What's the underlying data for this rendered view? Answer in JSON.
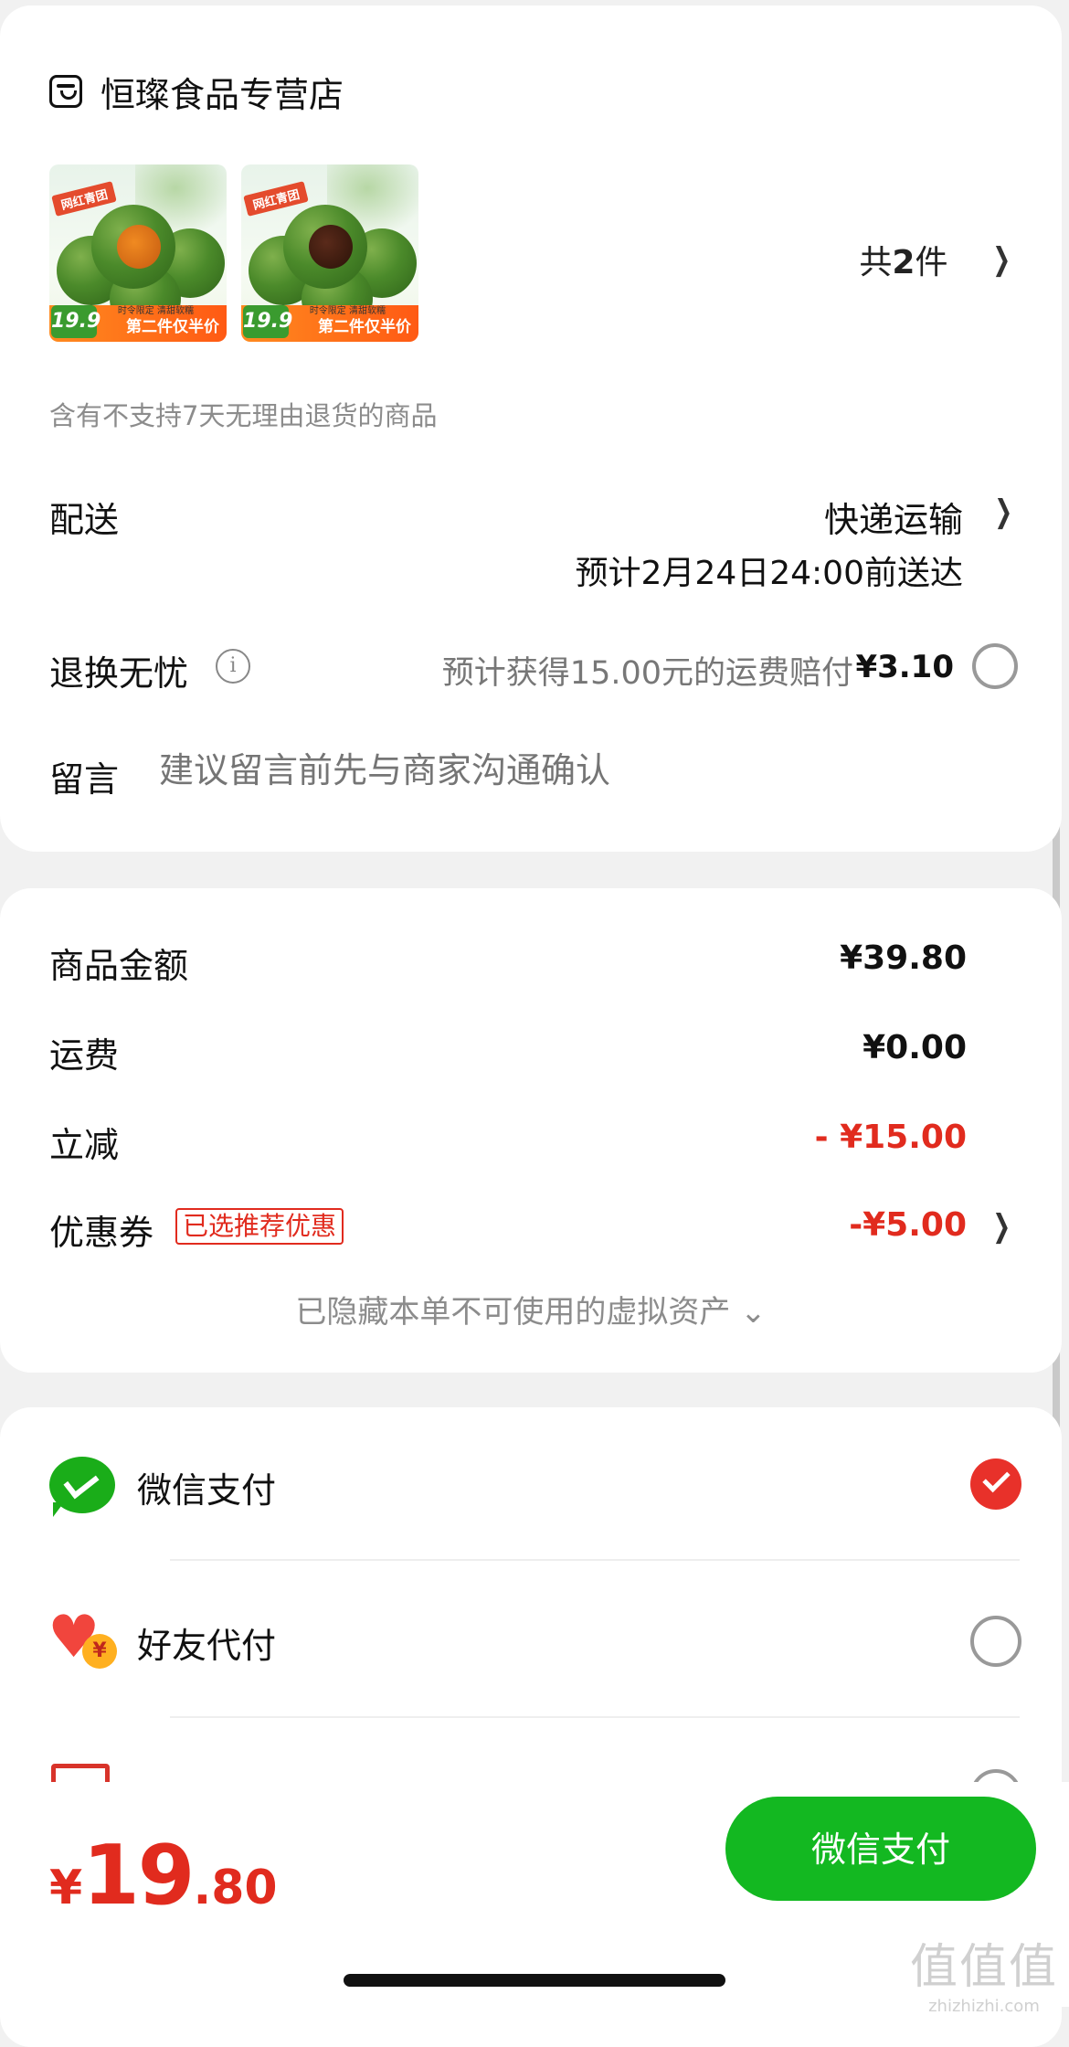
{
  "store": {
    "name": "恒璨食品专营店"
  },
  "products": [
    {
      "tag": "网红青团",
      "price_badge": "19.9",
      "band_text": "第二件仅半价",
      "band_small": "时令限定 清甜软糯",
      "filling_color": "#f08a21"
    },
    {
      "tag": "网红青团",
      "price_badge": "19.9",
      "band_text": "第二件仅半价",
      "band_small": "时令限定 清甜软糯",
      "filling_color": "#5a2a1a"
    }
  ],
  "item_count": {
    "prefix": "共",
    "count": "2",
    "suffix": "件"
  },
  "return_note": "含有不支持7天无理由退货的商品",
  "shipping": {
    "label": "配送",
    "method": "快递运输",
    "eta": "预计2月24日24:00前送达"
  },
  "return_worry_free": {
    "label": "退换无忧",
    "info_icon": "i",
    "description": "预计获得15.00元的运费赔付",
    "price": "¥3.10"
  },
  "message": {
    "label": "留言",
    "placeholder": "建议留言前先与商家沟通确认"
  },
  "summary": {
    "goods_amount_label": "商品金额",
    "goods_amount": "¥39.80",
    "shipping_fee_label": "运费",
    "shipping_fee": "¥0.00",
    "discount_label": "立减",
    "discount": "- ¥15.00",
    "coupon_label": "优惠券",
    "coupon_badge": "已选推荐优惠",
    "coupon_value": "-¥5.00",
    "hidden_assets": "已隐藏本单不可使用的虚拟资产 ⌄"
  },
  "payment_methods": {
    "wechat": "微信支付",
    "friend": "好友代付",
    "friend_coin": "¥",
    "third": "",
    "selected": "wechat"
  },
  "footer": {
    "total_symbol": "¥",
    "total_int": "19",
    "total_dec": ".80",
    "pay_button": "微信支付"
  },
  "watermark": {
    "big": "值值值",
    "small": "zhizhizhi.com"
  },
  "colors": {
    "accent_red": "#e12b1e",
    "wechat_green": "#13b821"
  },
  "icons": {
    "store": "store-icon",
    "chevron": "chevron-right-icon",
    "info": "info-icon",
    "wechat": "wechat-pay-icon",
    "friend": "friend-pay-icon",
    "check": "check-circle-icon"
  }
}
